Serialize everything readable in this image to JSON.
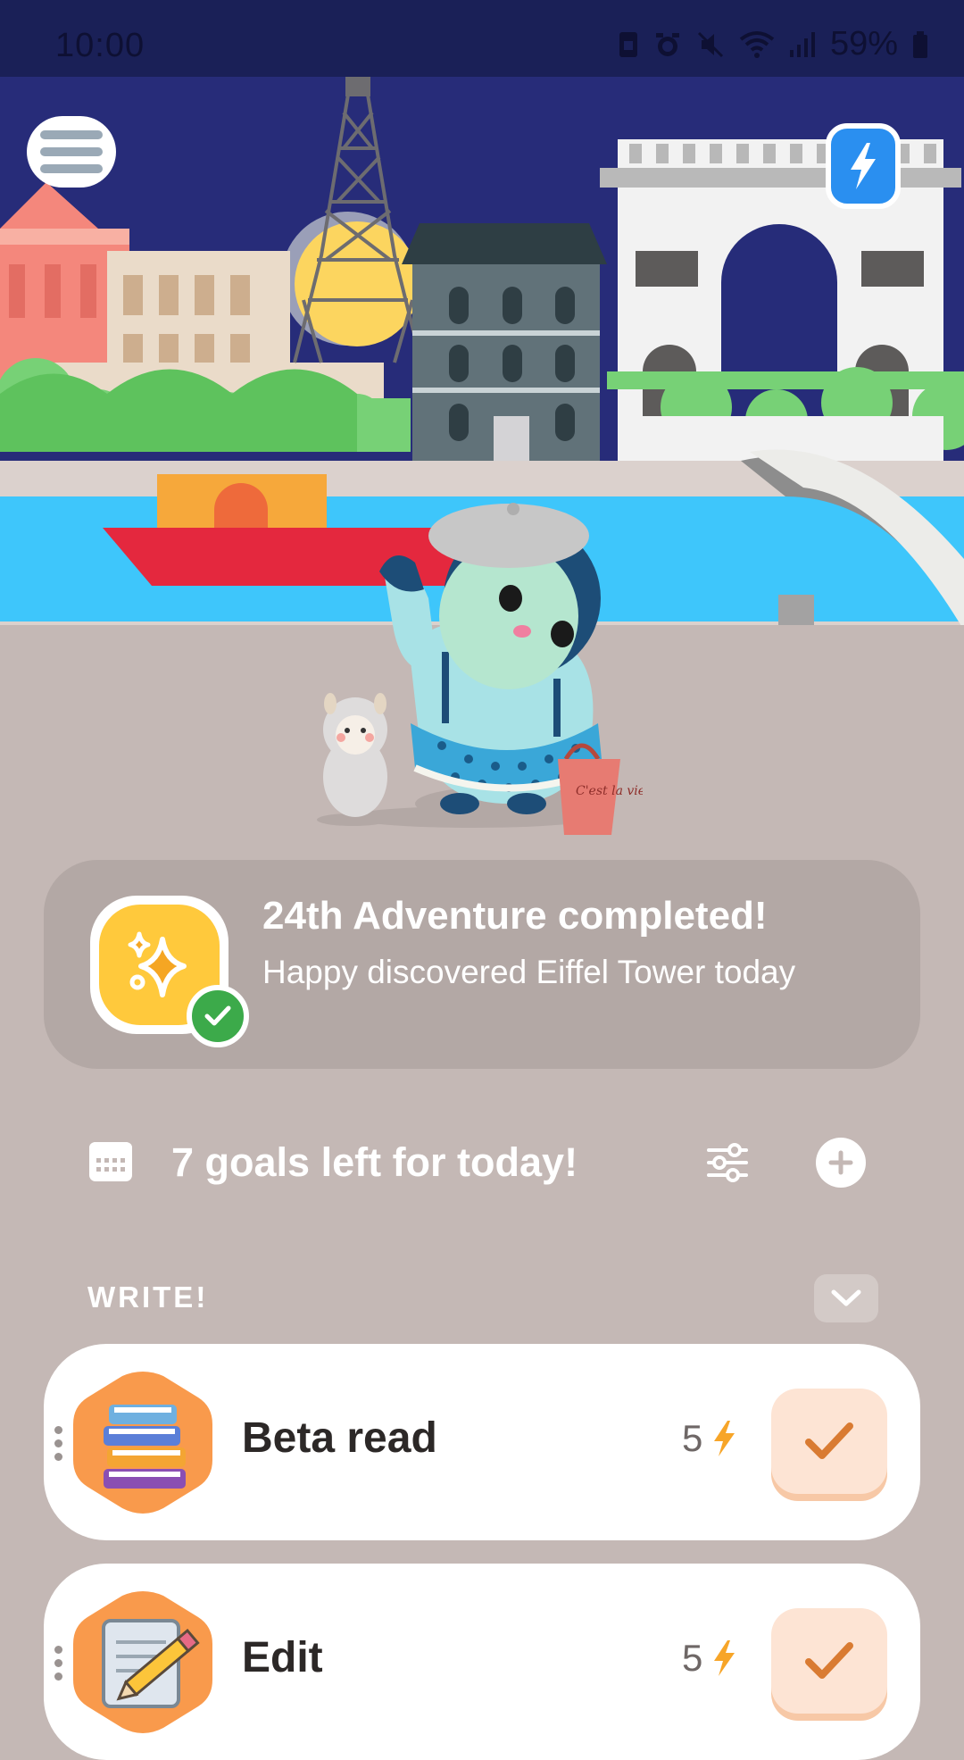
{
  "status_bar": {
    "time": "10:00",
    "battery": "59%",
    "icons": [
      "sim-icon",
      "alarm-icon",
      "mute-icon",
      "wifi-icon",
      "signal-icon",
      "battery-icon"
    ]
  },
  "scene": {
    "description_icons": [
      "eiffel-tower",
      "arc-de-triomphe",
      "boat",
      "bridge",
      "character",
      "alpaca"
    ],
    "bag_text": "C'est la vie"
  },
  "banner": {
    "title": "24th Adventure completed!",
    "subtitle": "Happy discovered Eiffel Tower today"
  },
  "goals": {
    "summary": "7 goals left for today!"
  },
  "section": {
    "label": "WRITE!"
  },
  "items": [
    {
      "name": "Beta read",
      "points": "5"
    },
    {
      "name": "Edit",
      "points": "5"
    }
  ],
  "colors": {
    "accent_orange": "#f99a4c",
    "energy_yellow": "#f7a528",
    "check_orange": "#d97b32",
    "badge_yellow": "#ffc93c",
    "success_green": "#3caa4a"
  }
}
